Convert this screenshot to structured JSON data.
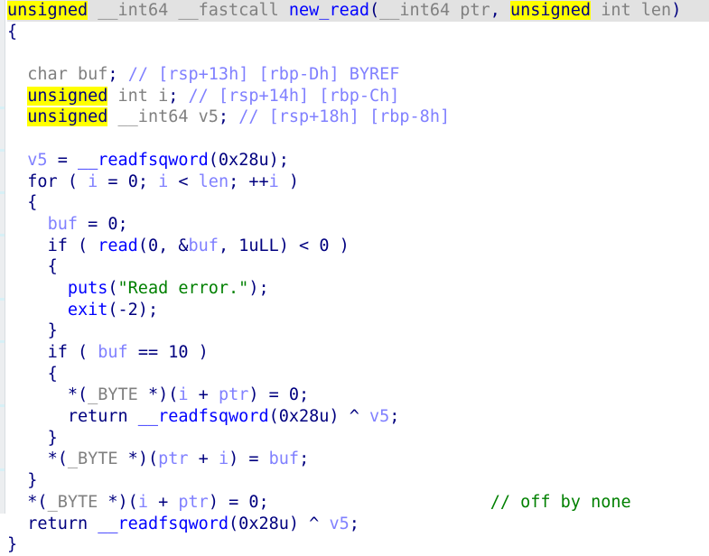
{
  "app": {
    "view_name": "pseudocode-decompiler-view",
    "function_name": "new_read"
  },
  "theme": {
    "background": "#ffffff",
    "current_line_background": "#e2e2e2",
    "highlight_background": "#ffff00",
    "keyword_color": "#00007f",
    "type_color": "#808080",
    "function_color": "#0000ff",
    "variable_color": "#8080ff",
    "string_color": "#008000",
    "comment_color": "#008000",
    "auto_comment_color": "#8080ff",
    "gutter_color": "#eceef0"
  },
  "code": {
    "line01": {
      "kw_unsigned": "unsigned",
      "sp1": " ",
      "type_int64": "__int64",
      "sp2": " ",
      "cc_fastcall": "__fastcall",
      "sp3": " ",
      "fn_name": "new_read",
      "paren_open": "(",
      "arg1_type": "__int64",
      "arg1_sp": " ",
      "arg1_name": "ptr",
      "comma": ", ",
      "arg2_unsigned": "unsigned",
      "arg2_sp": " ",
      "arg2_type": "int",
      "arg2_sp2": " ",
      "arg2_name": "len",
      "paren_close": ")"
    },
    "line02": {
      "brace": "{"
    },
    "line04": {
      "indent": "  ",
      "type": "char",
      "sp": " ",
      "name": "buf",
      "semi": ";",
      "sp2": " ",
      "comment": "// [rsp+13h] [rbp-Dh] BYREF"
    },
    "line05": {
      "indent": "  ",
      "kw_unsigned": "unsigned",
      "sp": " ",
      "type": "int",
      "sp2": " ",
      "name": "i",
      "semi": ";",
      "sp3": " ",
      "comment": "// [rsp+14h] [rbp-Ch]"
    },
    "line06": {
      "indent": "  ",
      "kw_unsigned": "unsigned",
      "sp": " ",
      "type": "__int64",
      "sp2": " ",
      "name": "v5",
      "semi": ";",
      "sp3": " ",
      "comment": "// [rsp+18h] [rbp-8h]"
    },
    "line08": {
      "indent": "  ",
      "var": "v5",
      "assign": " = ",
      "func": "__readfsqword",
      "args": "(0x28u);"
    },
    "line09": {
      "indent": "  ",
      "kw_for": "for",
      "open": " ( ",
      "v_i1": "i",
      "eq": " = ",
      "zero": "0",
      "semi1": "; ",
      "v_i2": "i",
      "lt": " < ",
      "v_len": "len",
      "semi2": "; ",
      "inc": "++",
      "v_i3": "i",
      "close": " )"
    },
    "line10": {
      "indent": "  ",
      "brace": "{"
    },
    "line11": {
      "indent": "    ",
      "var": "buf",
      "rest": " = 0;"
    },
    "line12": {
      "indent": "    ",
      "kw_if": "if",
      "open": " ( ",
      "func": "read",
      "a1": "(0, &",
      "var": "buf",
      "a2": ", 1uLL) < 0 )"
    },
    "line13": {
      "indent": "    ",
      "brace": "{"
    },
    "line14": {
      "indent": "      ",
      "func": "puts",
      "open": "(",
      "str": "\"Read error.\"",
      "close": ");"
    },
    "line15": {
      "indent": "      ",
      "func": "exit",
      "args": "(-2);"
    },
    "line16": {
      "indent": "    ",
      "brace": "}"
    },
    "line17": {
      "indent": "    ",
      "kw_if": "if",
      "open": " ( ",
      "var": "buf",
      "rest": " == 10 )"
    },
    "line18": {
      "indent": "    ",
      "brace": "{"
    },
    "line19": {
      "indent": "      ",
      "star": "*(",
      "type": "_BYTE",
      "star2": " *)(",
      "v_i": "i",
      "plus": " + ",
      "v_ptr": "ptr",
      "rest": ") = 0;"
    },
    "line20": {
      "indent": "      ",
      "kw_return": "return",
      "sp": " ",
      "func": "__readfsqword",
      "args": "(0x28u) ^ ",
      "var": "v5",
      "semi": ";"
    },
    "line21": {
      "indent": "    ",
      "brace": "}"
    },
    "line22": {
      "indent": "    ",
      "star": "*(",
      "type": "_BYTE",
      "star2": " *)(",
      "v_ptr": "ptr",
      "plus": " + ",
      "v_i": "i",
      "mid": ") = ",
      "var": "buf",
      "semi": ";"
    },
    "line23": {
      "indent": "  ",
      "brace": "}"
    },
    "line24": {
      "indent": "  ",
      "star": "*(",
      "type": "_BYTE",
      "star2": " *)(",
      "v_i": "i",
      "plus": " + ",
      "v_ptr": "ptr",
      "rest": ") = 0;",
      "pad": "                      ",
      "comment": "// off by none"
    },
    "line25": {
      "indent": "  ",
      "kw_return": "return",
      "sp": " ",
      "func": "__readfsqword",
      "args": "(0x28u) ^ ",
      "var": "v5",
      "semi": ";"
    },
    "line26": {
      "brace": "}"
    }
  }
}
